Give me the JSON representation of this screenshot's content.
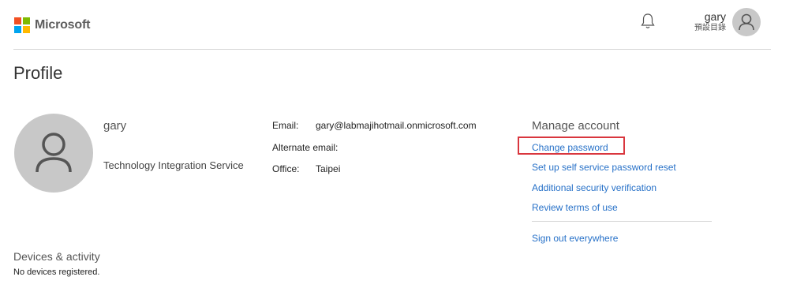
{
  "header": {
    "brand": "Microsoft",
    "brand_colors": [
      "#f25022",
      "#7fba00",
      "#00a4ef",
      "#ffb900"
    ],
    "notification_icon": "bell-icon",
    "user_name": "gary",
    "user_directory": "預設目錄",
    "user_icon": "person-icon"
  },
  "page": {
    "title": "Profile"
  },
  "profile": {
    "avatar_icon": "person-icon",
    "name": "gary",
    "organization": "Technology Integration Service"
  },
  "info": {
    "email_label": "Email:",
    "email_value": "gary@labmajihotmail.onmicrosoft.com",
    "alternate_email_label": "Alternate email:",
    "office_label": "Office:",
    "office_value": "Taipei"
  },
  "manage_account": {
    "title": "Manage account",
    "links": [
      "Change password",
      "Set up self service password reset",
      "Additional security verification",
      "Review terms of use"
    ],
    "sign_out": "Sign out everywhere",
    "highlight_color": "#d9363e",
    "link_color": "#2771c8"
  },
  "devices": {
    "title": "Devices & activity",
    "message": "No devices registered."
  }
}
